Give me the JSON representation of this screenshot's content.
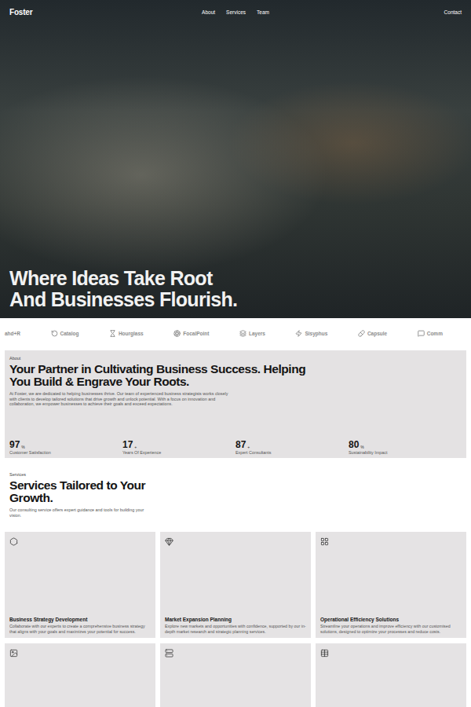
{
  "nav": {
    "logo": "Foster",
    "links": [
      {
        "label": "About"
      },
      {
        "label": "Services"
      },
      {
        "label": "Team"
      }
    ],
    "cta": "Contact"
  },
  "hero": {
    "headline_lines": [
      "Where Ideas Take Root",
      "And Businesses Flourish."
    ]
  },
  "logos": [
    "ahd+R",
    "Catalog",
    "Hourglass",
    "FocalPoint",
    "Layers",
    "Sisyphus",
    "Capsule",
    "Comm"
  ],
  "about": {
    "label": "About",
    "heading_lines": [
      "Your Partner in Cultivating Business Success. Helping",
      "You Build & Engrave Your Roots."
    ],
    "body": "At Foster, we are dedicated to helping businesses thrive. Our team of experienced business strategists works closely with clients to develop tailored solutions that drive growth and unlock potential. With a focus on innovation and collaboration, we empower businesses to achieve their goals and exceed expectations.",
    "stats": [
      {
        "value": "97",
        "unit": "%",
        "label": "Customer Satisfaction"
      },
      {
        "value": "17",
        "unit": "+",
        "label": "Years Of Experience"
      },
      {
        "value": "87",
        "unit": "+",
        "label": "Expert Consultants"
      },
      {
        "value": "80",
        "unit": "%",
        "label": "Sustainability Impact"
      }
    ]
  },
  "services": {
    "label": "Services",
    "heading_lines": [
      "Services Tailored to Your",
      "Growth."
    ],
    "body": "Our consulting service offers expert guidance and tools for building your vision.",
    "cards": [
      {
        "kind": "full",
        "title": "Business Strategy Development",
        "description": "Collaborate with our experts to create a comprehensive business strategy that aligns with your goals and maximizes your potential for success."
      },
      {
        "kind": "full",
        "title": "Market Expansion Planning",
        "description": "Explore new markets and opportunities with confidence, supported by our in-depth market research and strategic planning services."
      },
      {
        "kind": "full",
        "title": "Operational Efficiency Solutions",
        "description": "Streamline your operations and improve efficiency with our customised solutions, designed to optimize your processes and reduce costs."
      },
      {
        "kind": "cut"
      },
      {
        "kind": "cut"
      },
      {
        "kind": "cut"
      }
    ]
  }
}
